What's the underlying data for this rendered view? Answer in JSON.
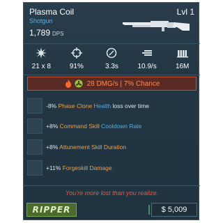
{
  "weapon": {
    "name": "Plasma Coil",
    "class": "Shotgun",
    "dps_value": "1,789",
    "dps_label": "DPS",
    "level": "Lvl 1"
  },
  "stats": [
    {
      "icon": "burst-icon",
      "value": "21 x 8"
    },
    {
      "icon": "crosshair-icon",
      "value": "91%"
    },
    {
      "icon": "reload-gauge-icon",
      "value": "3.3s"
    },
    {
      "icon": "fire-rate-icon",
      "value": "10.9/s"
    },
    {
      "icon": "magazine-icon",
      "value": "16M"
    }
  ],
  "damage": {
    "text": "28 DMG/s | 7% Chance",
    "accent": "#c8502a",
    "icons": [
      "fire-icon",
      "biohazard-icon"
    ]
  },
  "perks": [
    {
      "prefix": "-8%",
      "highlight": "Phase Clone",
      "highlight2": "Health",
      "suffix": "loss over time"
    },
    {
      "prefix": "+8%",
      "highlight": "Command Skill",
      "highlight2": "Cooldown Rate",
      "suffix": ""
    },
    {
      "prefix": "+8%",
      "highlight": "Attunement Skill Duration",
      "highlight2": "",
      "suffix": ""
    },
    {
      "prefix": "+11%",
      "highlight": "Forgeskill Damage",
      "highlight2": "",
      "suffix": ""
    }
  ],
  "flavor": "You're more lost than you realize.",
  "footer": {
    "brand": "RIPPER",
    "price": "$ 5,009"
  }
}
